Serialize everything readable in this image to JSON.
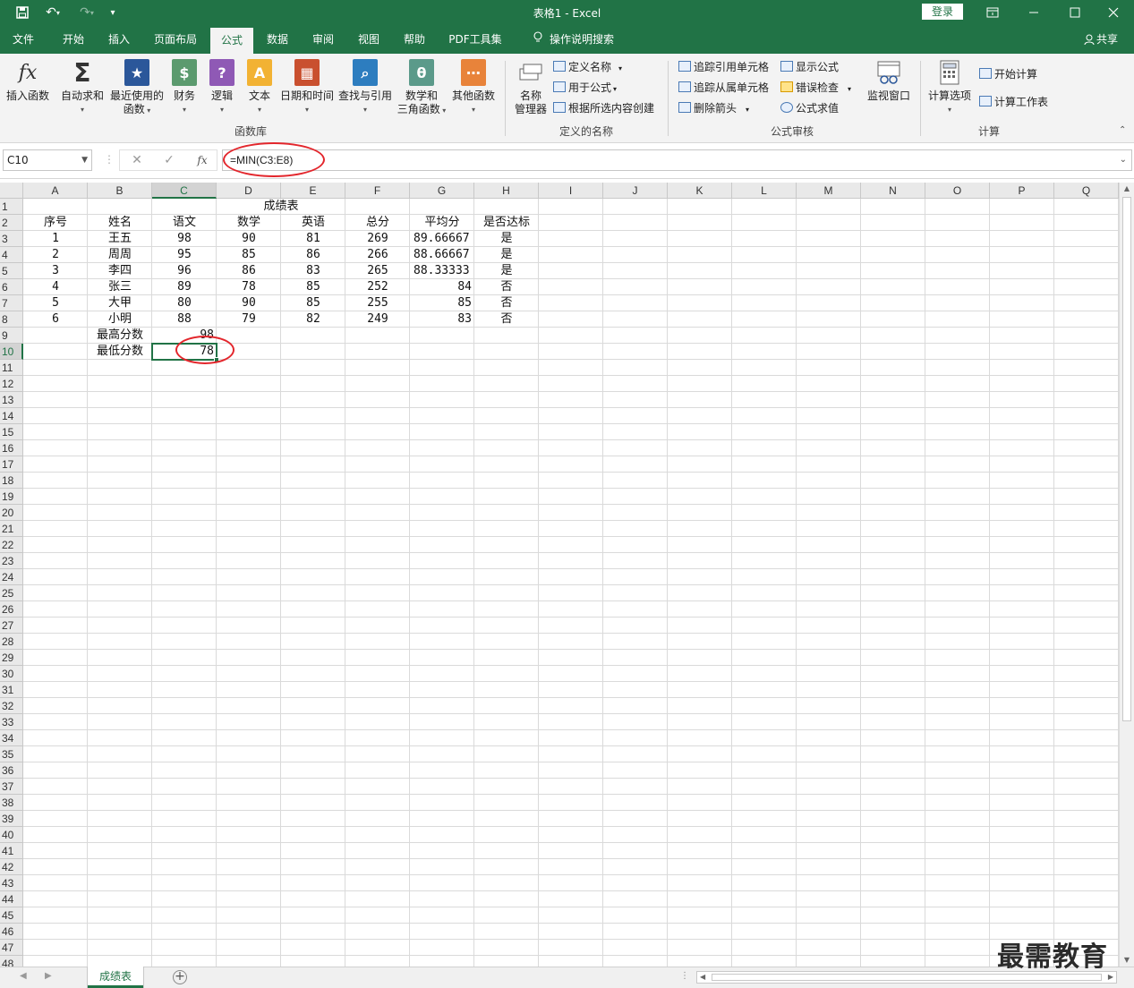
{
  "titlebar": {
    "title": "表格1  -  Excel",
    "login": "登录"
  },
  "menu": {
    "tabs": [
      "文件",
      "开始",
      "插入",
      "页面布局",
      "公式",
      "数据",
      "审阅",
      "视图",
      "帮助",
      "PDF工具集"
    ],
    "tellme": "操作说明搜索",
    "share": "共享",
    "active_tab": "公式"
  },
  "ribbon": {
    "insert_function": "插入函数",
    "autosum": "自动求和",
    "recent_line1": "最近使用的",
    "recent_line2": "函数",
    "financial": "财务",
    "logical": "逻辑",
    "text": "文本",
    "datetime": "日期和时间",
    "lookup": "查找与引用",
    "math_line1": "数学和",
    "math_line2": "三角函数",
    "other": "其他函数",
    "group_library": "函数库",
    "name_mgr_line1": "名称",
    "name_mgr_line2": "管理器",
    "define_name": "定义名称",
    "use_in_formula": "用于公式",
    "create_from_selection": "根据所选内容创建",
    "group_names": "定义的名称",
    "trace_precedents": "追踪引用单元格",
    "trace_dependents": "追踪从属单元格",
    "remove_arrows": "删除箭头",
    "show_formulas": "显示公式",
    "error_check": "错误检查",
    "evaluate": "公式求值",
    "watch_window": "监视窗口",
    "group_audit": "公式审核",
    "calc_options": "计算选项",
    "calc_now": "开始计算",
    "calc_sheet": "计算工作表",
    "group_calc": "计算"
  },
  "formula_bar": {
    "name_box": "C10",
    "formula": "=MIN(C3:E8)"
  },
  "sheet": {
    "columns": [
      "A",
      "B",
      "C",
      "D",
      "E",
      "F",
      "G",
      "H",
      "I",
      "J",
      "K",
      "L",
      "M",
      "N",
      "O",
      "P",
      "Q"
    ],
    "selected_column": "C",
    "selected_row": 10,
    "row_count": 48,
    "title": "成绩表",
    "headers": [
      "序号",
      "姓名",
      "语文",
      "数学",
      "英语",
      "总分",
      "平均分",
      "是否达标"
    ],
    "rows": [
      [
        "1",
        "王五",
        "98",
        "90",
        "81",
        "269",
        "89.66667",
        "是"
      ],
      [
        "2",
        "周周",
        "95",
        "85",
        "86",
        "266",
        "88.66667",
        "是"
      ],
      [
        "3",
        "李四",
        "96",
        "86",
        "83",
        "265",
        "88.33333",
        "是"
      ],
      [
        "4",
        "张三",
        "89",
        "78",
        "85",
        "252",
        "84",
        "否"
      ],
      [
        "5",
        "大甲",
        "80",
        "90",
        "85",
        "255",
        "85",
        "否"
      ],
      [
        "6",
        "小明",
        "88",
        "79",
        "82",
        "249",
        "83",
        "否"
      ]
    ],
    "max_label": "最高分数",
    "max_value": "98",
    "min_label": "最低分数",
    "min_value": "78"
  },
  "sheet_tabs": {
    "active": "成绩表"
  },
  "watermark": "最需教育",
  "colors": {
    "brand": "#217346",
    "annotation": "#e3262c"
  }
}
